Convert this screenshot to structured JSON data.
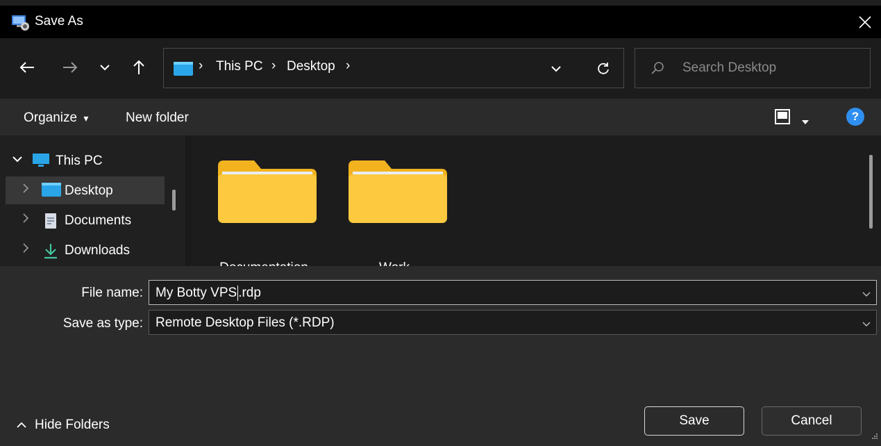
{
  "window": {
    "title": "Save As",
    "close_icon": "close-icon"
  },
  "navigation": {
    "back_icon": "arrow-left-icon",
    "forward_icon": "arrow-right-icon",
    "recent_icon": "chevron-down-icon",
    "up_icon": "arrow-up-icon"
  },
  "address_bar": {
    "breadcrumbs": [
      "This PC",
      "Desktop"
    ],
    "separator": "›"
  },
  "search": {
    "placeholder": "Search Desktop"
  },
  "toolbar": {
    "organize_label": "Organize",
    "organize_arrow": "▾",
    "new_folder_label": "New folder",
    "help_label": "?"
  },
  "nav_pane": {
    "items": [
      {
        "label": "This PC",
        "icon": "monitor-icon",
        "expanded": true
      },
      {
        "label": "Desktop",
        "icon": "desktop-folder-icon",
        "selected": true
      },
      {
        "label": "Documents",
        "icon": "document-icon"
      },
      {
        "label": "Downloads",
        "icon": "download-icon"
      }
    ]
  },
  "files": {
    "items": [
      {
        "name": "Documentation",
        "icon": "folder-icon"
      },
      {
        "name": "Work",
        "icon": "folder-icon"
      }
    ]
  },
  "form": {
    "file_name_label": "File name:",
    "file_name_before_caret": "My Botty VPS",
    "file_name_after_caret": ".rdp",
    "save_type_label": "Save as type:",
    "save_type_value": "Remote Desktop Files (*.RDP)"
  },
  "footer": {
    "hide_folders_label": "Hide Folders",
    "save_label": "Save",
    "cancel_label": "Cancel"
  },
  "colors": {
    "help_accent": "#2f8ff0",
    "folder_yellow": "#fcc93f",
    "download_green": "#45c4a0"
  }
}
